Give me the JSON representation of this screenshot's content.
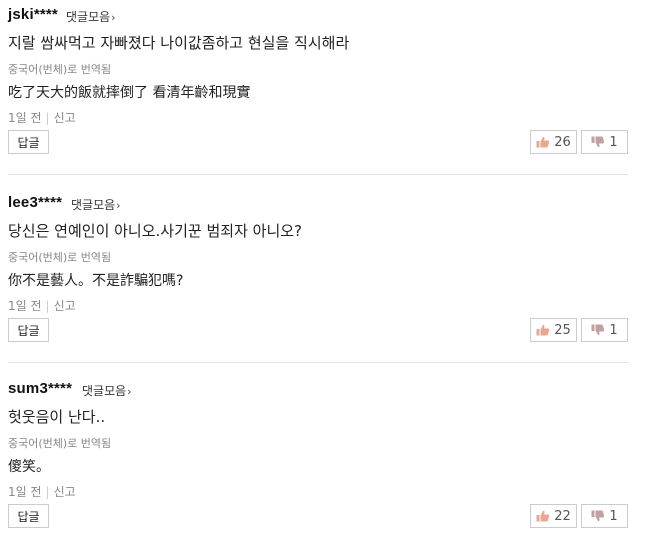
{
  "comments": [
    {
      "username": "jski****",
      "collection_label": "댓글모음",
      "original": "지랄 쌈싸먹고 자빠졌다 나이값좀하고 현실을 직시해라",
      "translated_label": "중국어(번체)로 번역됨",
      "translated": "吃了天大的飯就摔倒了 看清年齡和現實",
      "time": "1일 전",
      "report": "신고",
      "reply_label": "답글",
      "likes": "26",
      "dislikes": "1"
    },
    {
      "username": "lee3****",
      "collection_label": "댓글모음",
      "original": "당신은 연예인이 아니오.사기꾼 범죄자 아니오?",
      "translated_label": "중국어(번체)로 번역됨",
      "translated": "你不是藝人。不是詐騙犯嗎?",
      "time": "1일 전",
      "report": "신고",
      "reply_label": "답글",
      "likes": "25",
      "dislikes": "1"
    },
    {
      "username": "sum3****",
      "collection_label": "댓글모음",
      "original": "헛웃음이 난다..",
      "translated_label": "중국어(번체)로 번역됨",
      "translated": "傻笑。",
      "time": "1일 전",
      "report": "신고",
      "reply_label": "답글",
      "likes": "22",
      "dislikes": "1"
    }
  ],
  "icons": {
    "like": "thumbs-up-icon",
    "dislike": "thumbs-down-icon",
    "chevron": "chevron-right-icon"
  },
  "colors": {
    "like_icon": "#e8a890",
    "dislike_icon": "#c0a0a0"
  }
}
